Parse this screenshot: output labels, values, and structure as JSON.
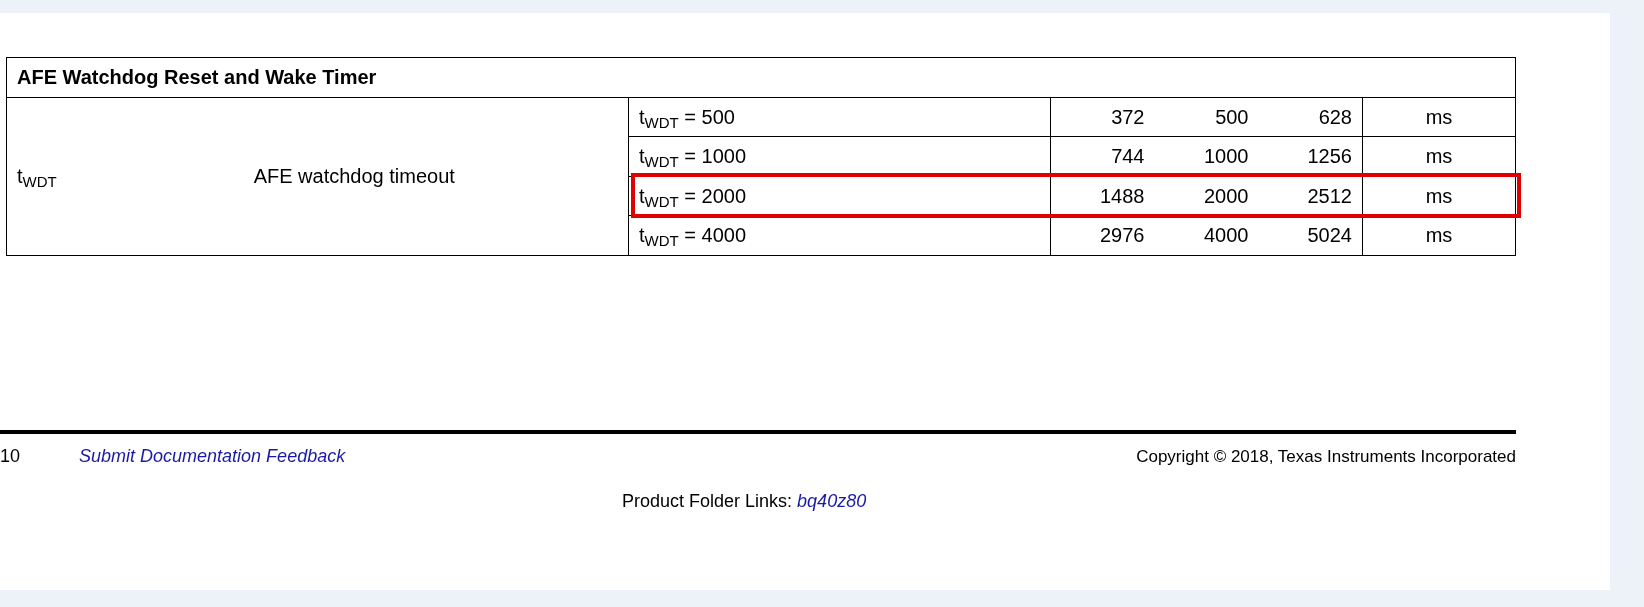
{
  "table": {
    "title": "AFE Watchdog Reset and Wake Timer",
    "symbol": "t$_{WDT}$",
    "description": "AFE watchdog timeout",
    "rows": [
      {
        "condition": "t$_{WDT}$ = 500",
        "min": "372",
        "typ": "500",
        "max": "628",
        "unit": "ms",
        "highlighted": false
      },
      {
        "condition": "t$_{WDT}$ = 1000",
        "min": "744",
        "typ": "1000",
        "max": "1256",
        "unit": "ms",
        "highlighted": false
      },
      {
        "condition": "t$_{WDT}$ = 2000",
        "min": "1488",
        "typ": "2000",
        "max": "2512",
        "unit": "ms",
        "highlighted": true
      },
      {
        "condition": "t$_{WDT}$ = 4000",
        "min": "2976",
        "typ": "4000",
        "max": "5024",
        "unit": "ms",
        "highlighted": false
      }
    ]
  },
  "footer": {
    "page_number": "10",
    "feedback_link": "Submit Documentation Feedback",
    "copyright": "Copyright © 2018, Texas Instruments Incorporated",
    "product_folder_label": "Product Folder Links:",
    "product_link": "bq40z80"
  }
}
